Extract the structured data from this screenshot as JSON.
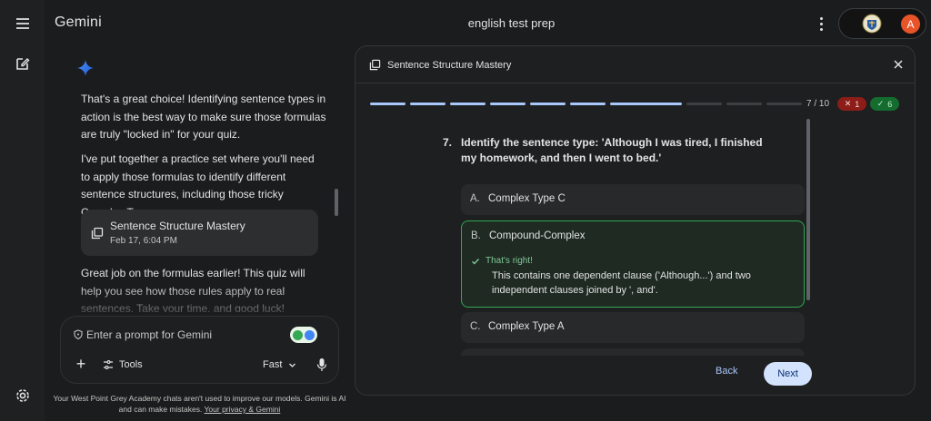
{
  "app": {
    "title": "Gemini",
    "chat_title": "english test prep",
    "avatar_initial": "A"
  },
  "chat": {
    "messages": [
      "That's a great choice! Identifying sentence types in action is the best way to make sure those formulas are truly \"locked in\" for your quiz.",
      "I've put together a practice set where you'll need to apply those formulas to identify different sentence structures, including those tricky Complex Types.",
      "Great job on the formulas earlier! This quiz will help you see how those rules apply to real sentences. Take your time, and good luck!"
    ],
    "quiz_card": {
      "title": "Sentence Structure Mastery",
      "date": "Feb 17, 6:04 PM"
    }
  },
  "prompt": {
    "placeholder": "Enter a prompt for Gemini",
    "tools_label": "Tools",
    "mode_label": "Fast"
  },
  "disclaimer": {
    "text": "Your West Point Grey Academy chats aren't used to improve our models. Gemini is AI and can make mistakes. ",
    "link": "Your privacy & Gemini"
  },
  "quiz": {
    "title": "Sentence Structure Mastery",
    "progress": {
      "current": 7,
      "total": 10,
      "label": "7 / 10"
    },
    "wrong_count": "1",
    "right_count": "6",
    "question_number": "7.",
    "question": "Identify the sentence type: 'Although I was tired, I finished my homework, and then I went to bed.'",
    "options": [
      {
        "letter": "A.",
        "text": "Complex Type C"
      },
      {
        "letter": "B.",
        "text": "Compound-Complex"
      },
      {
        "letter": "C.",
        "text": "Complex Type A"
      }
    ],
    "feedback": {
      "title": "That's right!",
      "text": "This contains one dependent clause ('Although...') and two independent clauses joined by ', and'."
    },
    "back_label": "Back",
    "next_label": "Next"
  },
  "colors": {
    "accent": "#a8c7fa",
    "correct": "#34a853",
    "wrong_badge": "#8c1d18",
    "right_badge": "#146c2e",
    "avatar": "#e8542a"
  }
}
